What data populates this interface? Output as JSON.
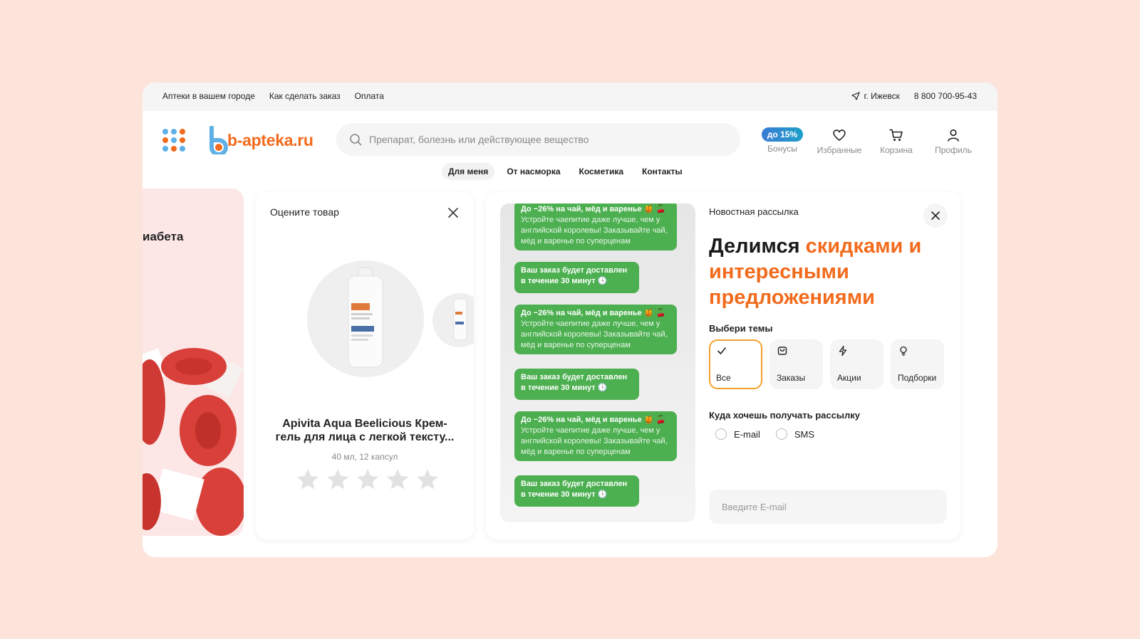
{
  "topbar": {
    "links": [
      "Аптеки в вашем городе",
      "Как сделать заказ",
      "Оплата"
    ],
    "city": "г. Ижевск",
    "phone": "8 800 700-95-43"
  },
  "header": {
    "logo_text": "b-apteka.ru",
    "search_placeholder": "Препарат, болезнь или действующее вещество",
    "bonus_badge": "до 15%",
    "bonus_label": "Бонусы",
    "favorites_label": "Избранные",
    "cart_label": "Корзина",
    "profile_label": "Профиль"
  },
  "nav": {
    "items": [
      "Для меня",
      "От насморка",
      "Косметика",
      "Контакты"
    ],
    "active": "Для меня"
  },
  "left_card": {
    "title": "иабета"
  },
  "rate_card": {
    "title": "Оцените товар",
    "product_name": "Apivita Aqua Beelicious Крем-гель для лица с легкой тексту...",
    "product_sub": "40 мл, 12 капсул",
    "stars_total": 5,
    "stars_filled": 0
  },
  "chat": {
    "promo_title": "До −26% на чай, мёд и варенье 🍯 🍒",
    "promo_body": "Устройте чаепитие даже лучше, чем у английской королевы! Заказывайте чай, мёд и варенье по суперценам",
    "delivery_line1": "Ваш заказ будет доставлен",
    "delivery_line2": "в течение 30 минут 🕓"
  },
  "newsletter": {
    "title": "Новостная рассылка",
    "headline_dark": "Делимся ",
    "headline_orange1": "скидками",
    "headline_orange2": "и интересными предложениями",
    "topics_label": "Выбери темы",
    "topics": [
      "Все",
      "Заказы",
      "Акции",
      "Подборки"
    ],
    "selected_topic": "Все",
    "where_label": "Куда хочешь получать рассылку",
    "channels": [
      "E-mail",
      "SMS"
    ],
    "email_placeholder": "Введите E-mail"
  },
  "colors": {
    "accent_orange": "#f26b1d",
    "chat_green": "#4caf50",
    "background": "#fde4da",
    "topic_selected_border": "#f5a12b"
  }
}
